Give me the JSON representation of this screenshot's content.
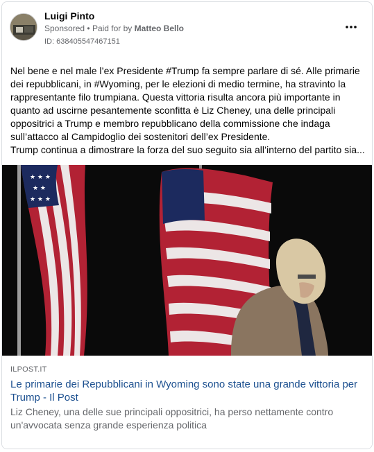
{
  "post": {
    "author": "Luigi Pinto",
    "sponsored": "Sponsored",
    "separator": "•",
    "paid_for_by_label": "Paid for by",
    "paid_for_by_name": "Matteo Bello",
    "ad_id": "ID: 638405547467151",
    "more_icon": "more-horizontal-icon",
    "text_paragraphs": [
      "Nel bene e nel male l’ex Presidente #Trump fa sempre parlare di sé. Alle primarie dei repubblicani, in #Wyoming, per le elezioni di medio termine, ha stravinto la rappresentante filo trumpiana. Questa vittoria risulta ancora più importante in quanto ad uscirne pesantemente sconfitta è Liz Cheney, una delle principali oppositrici a Trump e membro repubblicano della commissione che indaga sull’attacco al Campidoglio dei sostenitori dell’ex Presidente.",
      "Trump continua a dimostrare la forza del suo seguito sia all’interno del partito sia..."
    ]
  },
  "link": {
    "domain": "ILPOST.IT",
    "headline": "Le primarie dei Repubblicani in Wyoming sono state una grande vittoria per Trump - Il Post",
    "description": "Liz Cheney, una delle sue principali oppositrici, ha perso nettamente contro un'avvocata senza grande esperienza politica"
  },
  "colors": {
    "headline": "#1b4f8f",
    "secondary_text": "#65676b",
    "primary_text": "#050505",
    "flag_red": "#b22234",
    "flag_blue": "#1c2a5e"
  }
}
